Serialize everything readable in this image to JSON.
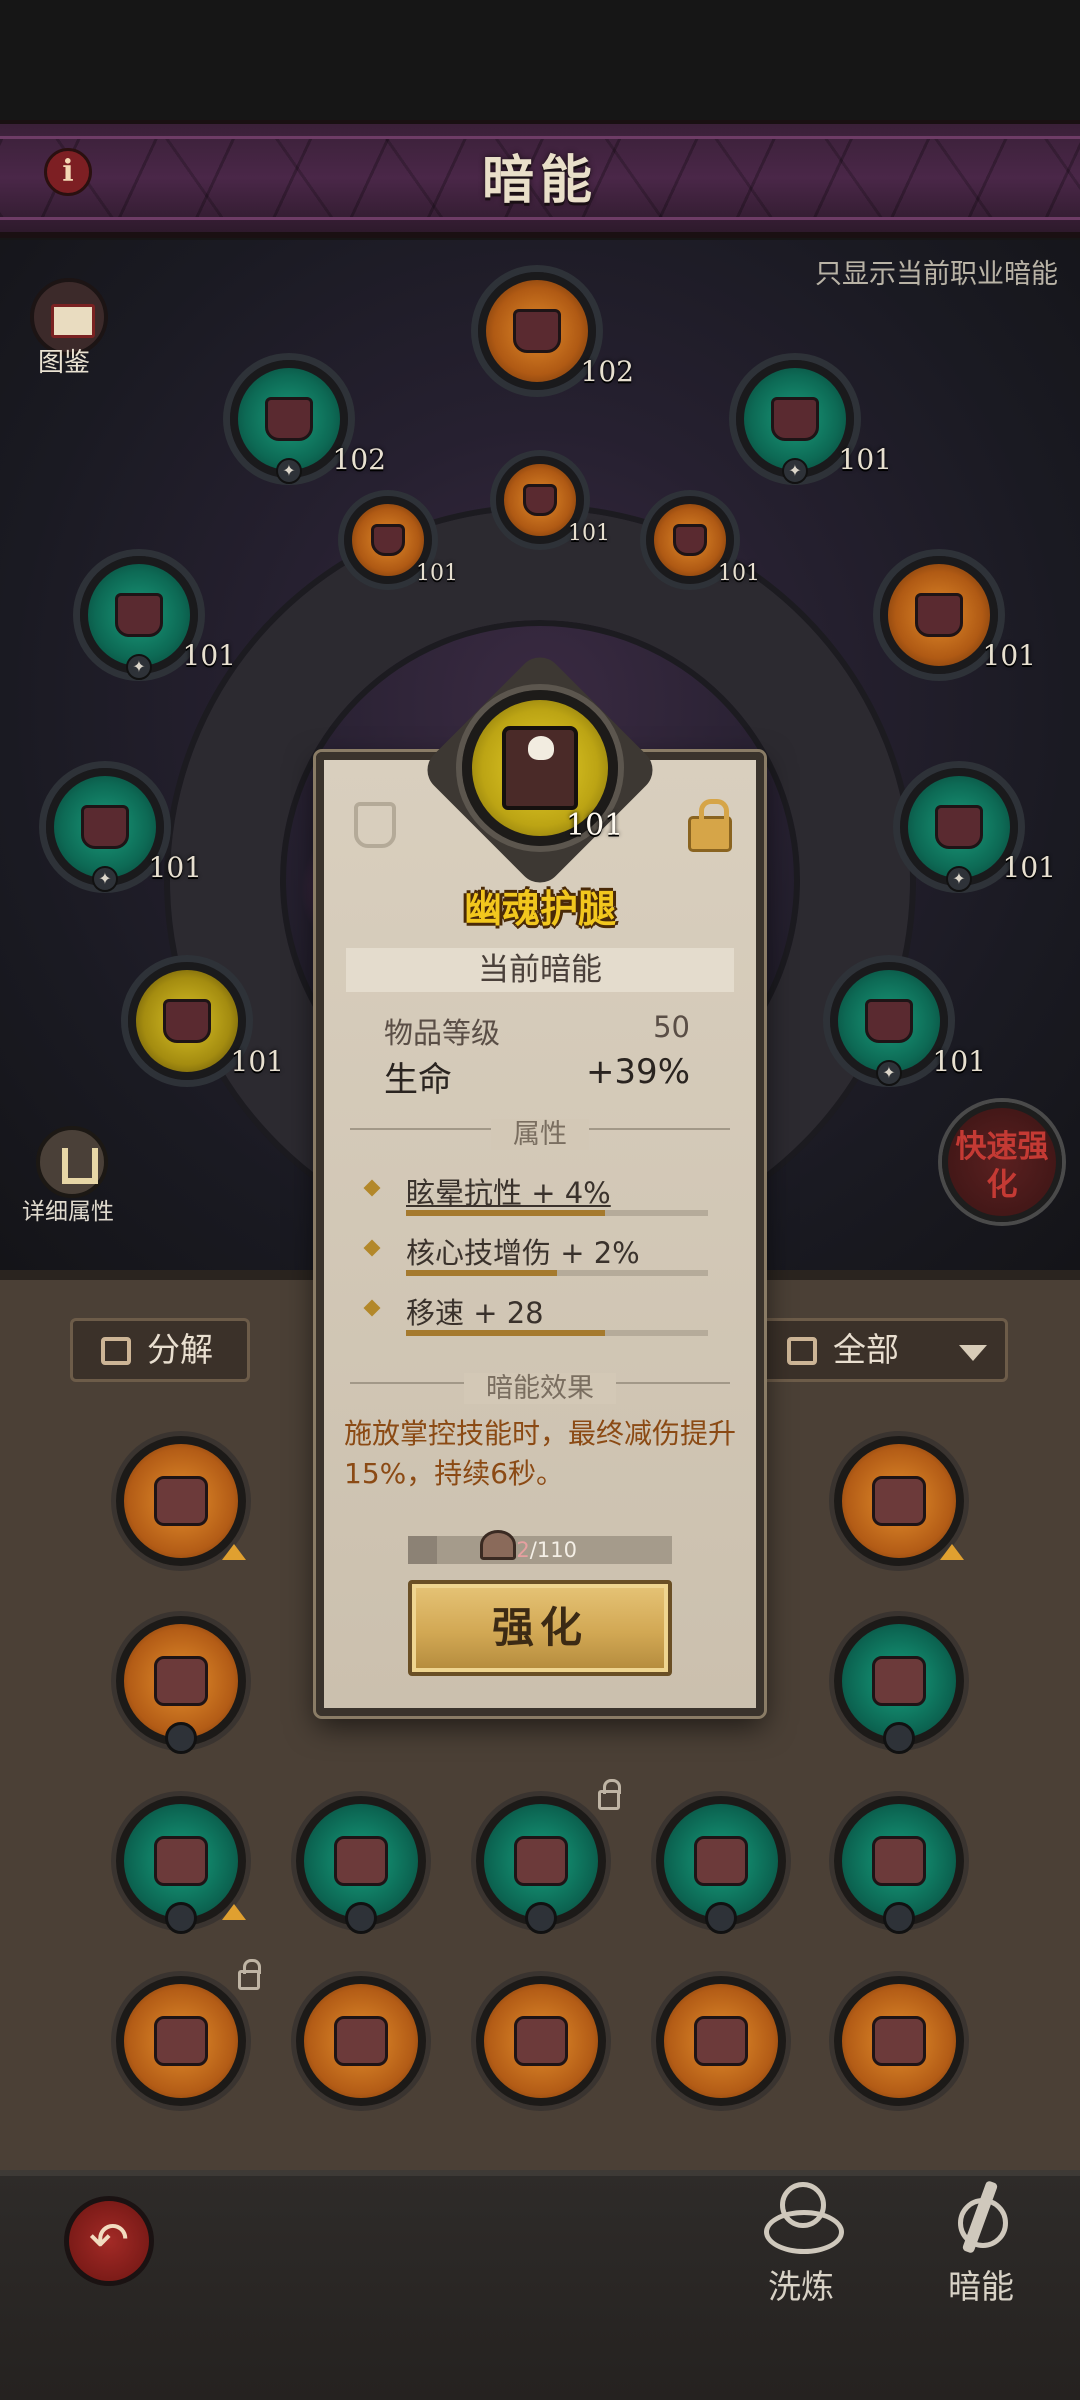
{
  "header": {
    "title": "暗能",
    "info_label": "i"
  },
  "filter_note": "只显示当前职业暗能",
  "side": {
    "codex_label": "图鉴",
    "detail_label": "详细属性",
    "quick_upgrade_label": "快速强化"
  },
  "slots": [
    {
      "lvl": "102",
      "color": "orange"
    },
    {
      "lvl": "102",
      "color": "green"
    },
    {
      "lvl": "101",
      "color": "green"
    },
    {
      "lvl": "101",
      "color": "orange"
    },
    {
      "lvl": "101",
      "color": "orange"
    },
    {
      "lvl": "101",
      "color": "orange"
    },
    {
      "lvl": "101",
      "color": "green"
    },
    {
      "lvl": "101",
      "color": "orange"
    },
    {
      "lvl": "101",
      "color": "green"
    },
    {
      "lvl": "101",
      "color": "green"
    },
    {
      "lvl": "101",
      "color": "yellow"
    },
    {
      "lvl": "101",
      "color": "green"
    }
  ],
  "inventory": {
    "decompose_label": "分解",
    "filter_all_label": "全部"
  },
  "popup": {
    "item_name": "幽魂护腿",
    "item_level": "101",
    "section_current": "当前暗能",
    "item_level_label": "物品等级",
    "item_level_value": "50",
    "main_stat_label": "生命",
    "main_stat_value": "+39%",
    "attributes_title": "属性",
    "attributes": [
      {
        "text": "眩晕抗性 + 4%",
        "fill": 0.66
      },
      {
        "text": "核心技增伤 + 2%",
        "fill": 0.5
      },
      {
        "text": "移速 + 28",
        "fill": 0.66
      }
    ],
    "effect_title": "暗能效果",
    "effect_text": "施放掌控技能时，最终减伤提升15%，持续6秒。",
    "material_current": "12",
    "material_total": "/110",
    "material_fraction": 0.109,
    "upgrade_label": "强化"
  },
  "bottom_nav": {
    "back_icon": "back-arrow-icon",
    "wash_label": "洗炼",
    "dark_label": "暗能"
  },
  "colors": {
    "accent_gold": "#f2c71e",
    "slot_green": "#0d6a55",
    "slot_orange": "#b05a14",
    "effect_text": "#8b4a14"
  }
}
